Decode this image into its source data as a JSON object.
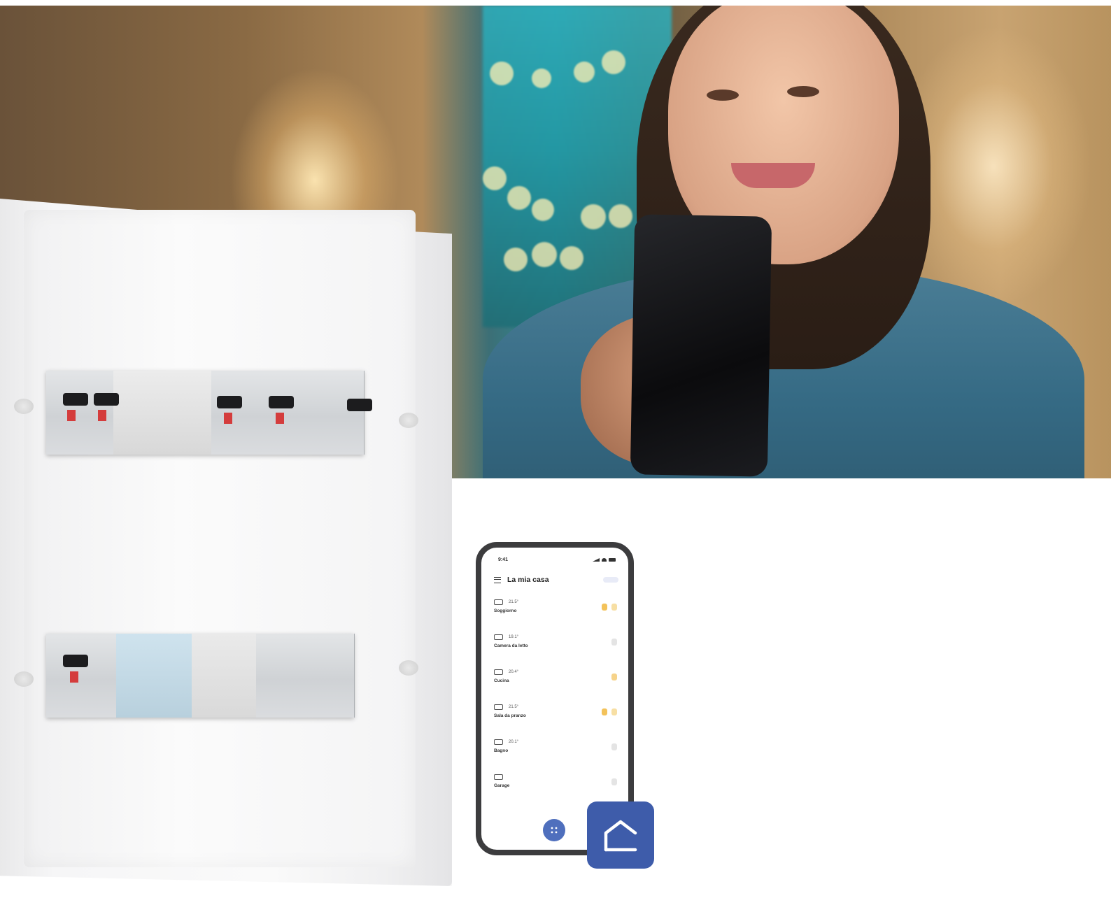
{
  "phone": {
    "status_time": "9:41",
    "title": "La mia casa",
    "rooms": [
      {
        "temp": "21.5°",
        "name": "Soggiorno",
        "icon": "sofa-icon"
      },
      {
        "temp": "19.1°",
        "name": "Camera da letto",
        "icon": "bed-icon"
      },
      {
        "temp": "20.4°",
        "name": "Cucina",
        "icon": "pot-icon"
      },
      {
        "temp": "21.5°",
        "name": "Sala da pranzo",
        "icon": "dining-icon"
      },
      {
        "temp": "20.1°",
        "name": "Bagno",
        "icon": "bath-icon"
      },
      {
        "temp": "",
        "name": "Garage",
        "icon": "garage-icon"
      }
    ],
    "fab_icon": "grid-icon"
  },
  "badge_icon": "home-icon",
  "colors": {
    "badge": "#3e5caa",
    "fab": "#4f6fbd",
    "light_on": "#f3c25a",
    "light_off": "#e4e4e4"
  }
}
